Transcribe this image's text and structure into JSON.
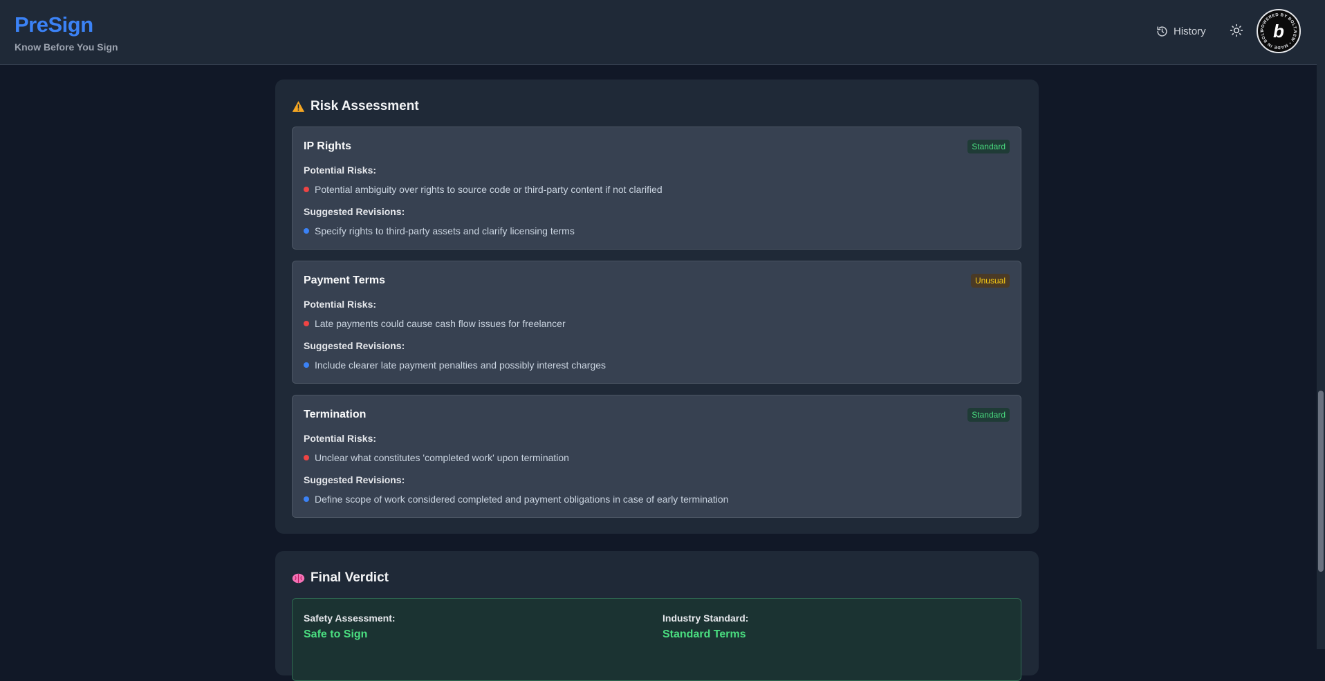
{
  "header": {
    "title": "PreSign",
    "subtitle": "Know Before You Sign",
    "history_label": "History",
    "history_icon": "history-icon",
    "theme_icon": "sun-icon",
    "bolt_badge_text": "POWERED BY BOLT.NEW • MADE IN BOLT.NEW •",
    "bolt_badge_letter": "b"
  },
  "risk_assessment": {
    "icon": "warning-icon",
    "title": "Risk Assessment",
    "potential_risks_label": "Potential Risks:",
    "suggested_revisions_label": "Suggested Revisions:",
    "items": [
      {
        "name": "IP Rights",
        "badge": "Standard",
        "risk": "Potential ambiguity over rights to source code or third-party content if not clarified",
        "revision": "Specify rights to third-party assets and clarify licensing terms"
      },
      {
        "name": "Payment Terms",
        "badge": "Unusual",
        "risk": "Late payments could cause cash flow issues for freelancer",
        "revision": "Include clearer late payment penalties and possibly interest charges"
      },
      {
        "name": "Termination",
        "badge": "Standard",
        "risk": "Unclear what constitutes 'completed work' upon termination",
        "revision": "Define scope of work considered completed and payment obligations in case of early termination"
      }
    ]
  },
  "final_verdict": {
    "icon": "brain-icon",
    "title": "Final Verdict",
    "safety_label": "Safety Assessment:",
    "safety_value": "Safe to Sign",
    "industry_label": "Industry Standard:",
    "industry_value": "Standard Terms"
  },
  "colors": {
    "accent": "#3b82f6",
    "risk_dot": "#ef4444",
    "revision_dot": "#3b82f6",
    "standard": "#4ade80",
    "unusual": "#facc15"
  }
}
